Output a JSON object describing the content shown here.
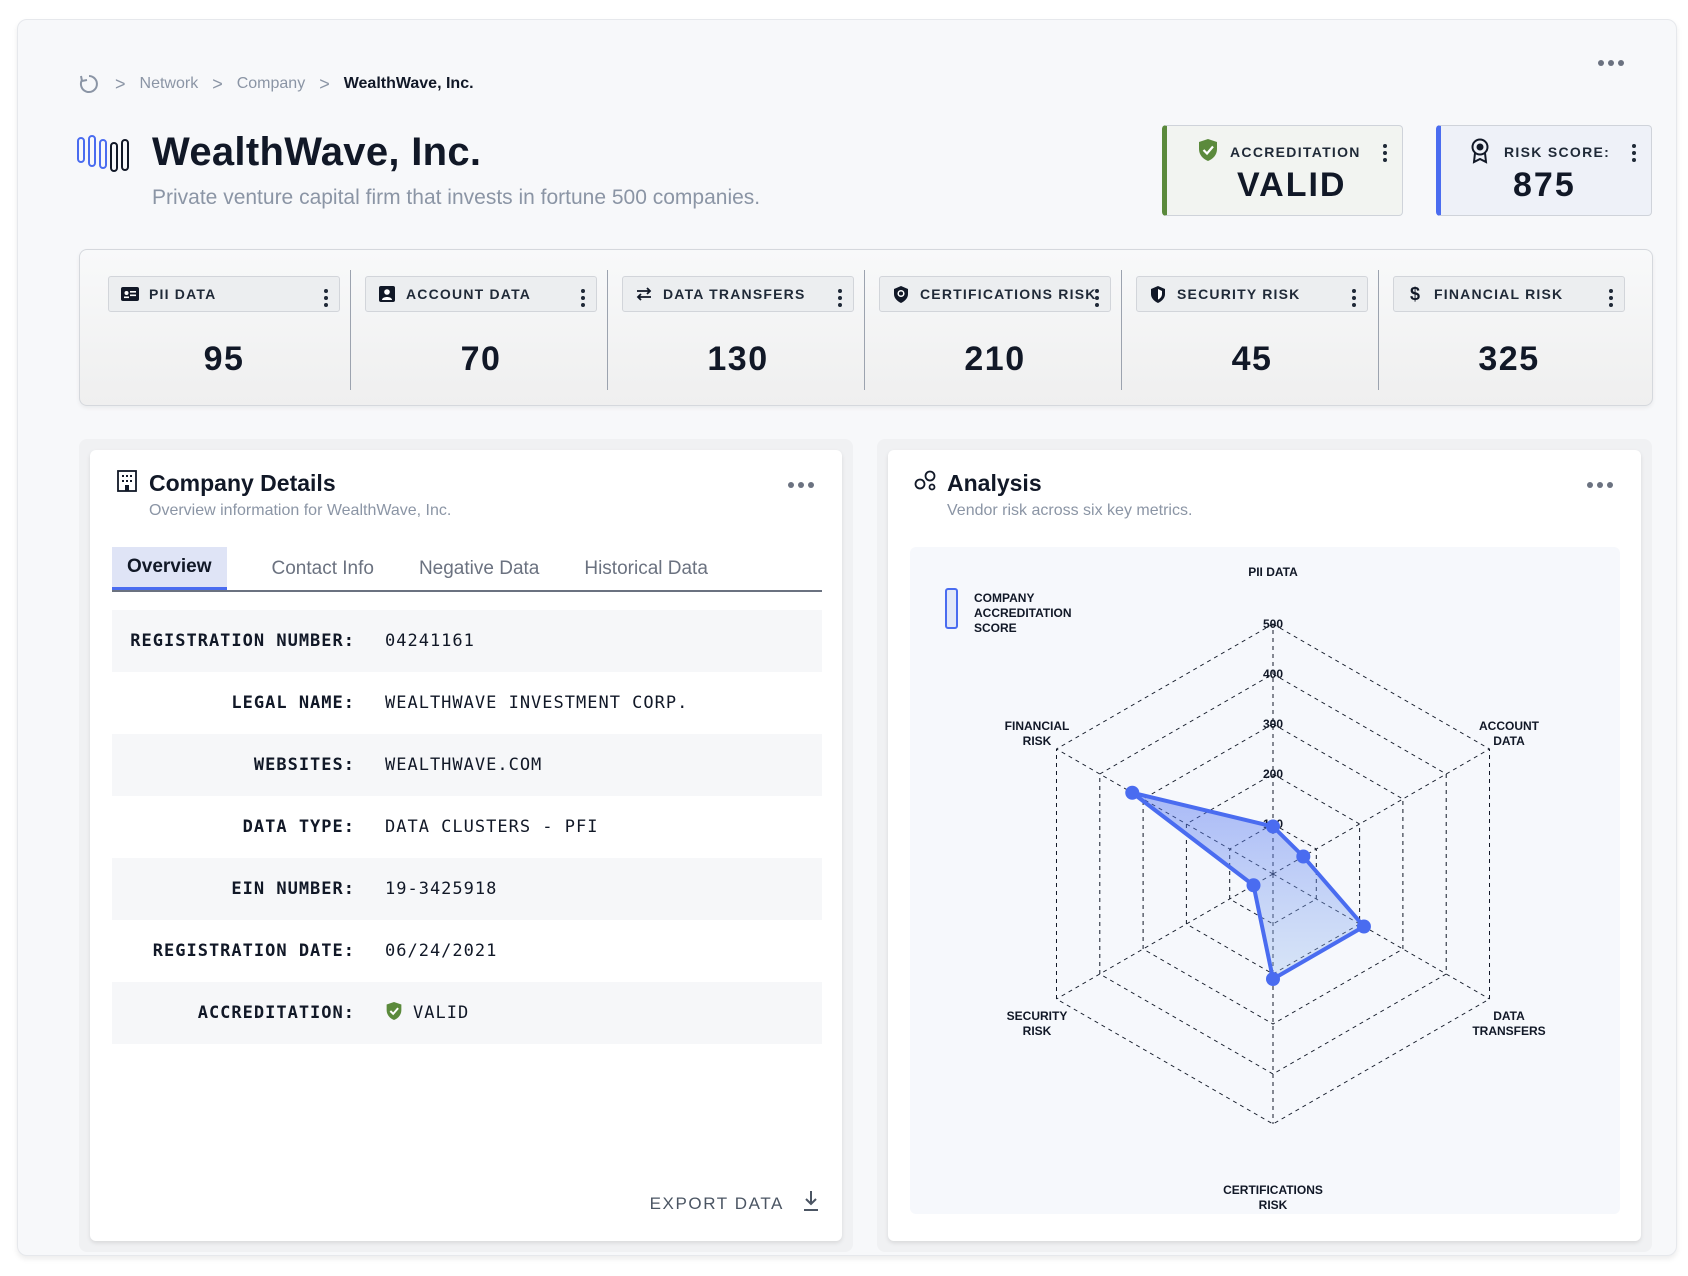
{
  "breadcrumb": {
    "items": [
      "Network",
      "Company"
    ],
    "current": "WealthWave, Inc."
  },
  "header": {
    "title": "WealthWave, Inc.",
    "subtitle": "Private venture capital firm that invests in fortune 500 companies.",
    "accreditation": {
      "label": "ACCREDITATION",
      "value": "VALID",
      "color": "#5b8a3c"
    },
    "risk_score": {
      "label": "RISK SCORE:",
      "value": "875",
      "color": "#4a6cf0"
    }
  },
  "metrics": [
    {
      "label": "PII DATA",
      "value": "95",
      "icon": "id-card-icon"
    },
    {
      "label": "ACCOUNT DATA",
      "value": "70",
      "icon": "account-icon"
    },
    {
      "label": "DATA TRANSFERS",
      "value": "130",
      "icon": "transfer-arrows-icon"
    },
    {
      "label": "CERTIFICATIONS RISK",
      "value": "210",
      "icon": "certificate-shield-icon"
    },
    {
      "label": "SECURITY RISK",
      "value": "45",
      "icon": "shield-icon"
    },
    {
      "label": "FINANCIAL RISK",
      "value": "325",
      "icon": "dollar-icon"
    }
  ],
  "company_details": {
    "title": "Company Details",
    "subtitle": "Overview information for WealthWave, Inc.",
    "tabs": [
      "Overview",
      "Contact Info",
      "Negative Data",
      "Historical Data"
    ],
    "active_tab": "Overview",
    "rows": [
      {
        "key": "REGISTRATION NUMBER:",
        "value": "04241161"
      },
      {
        "key": "LEGAL NAME:",
        "value": "WEALTHWAVE INVESTMENT CORP."
      },
      {
        "key": "WEBSITES:",
        "value": "WEALTHWAVE.COM"
      },
      {
        "key": "DATA TYPE:",
        "value": "DATA CLUSTERS - PFI"
      },
      {
        "key": "EIN NUMBER:",
        "value": "19-3425918"
      },
      {
        "key": "REGISTRATION DATE:",
        "value": "06/24/2021"
      },
      {
        "key": "ACCREDITATION:",
        "value": "VALID"
      }
    ],
    "export_label": "EXPORT DATA"
  },
  "analysis": {
    "title": "Analysis",
    "subtitle": "Vendor risk across six key metrics."
  },
  "chart_data": {
    "type": "radar",
    "legend": "COMPANY ACCREDITATION SCORE",
    "axes": [
      "PII DATA",
      "ACCOUNT DATA",
      "DATA TRANSFERS",
      "CERTIFICATIONS RISK",
      "SECURITY RISK",
      "FINANCIAL RISK"
    ],
    "ticks": [
      "100",
      "200",
      "300",
      "400",
      "500"
    ],
    "range": [
      0,
      500
    ],
    "series": [
      {
        "values": [
          95,
          70,
          210,
          210,
          45,
          325
        ]
      }
    ],
    "fill_color": "#4a6cf0",
    "legend_placement": "top-left"
  }
}
